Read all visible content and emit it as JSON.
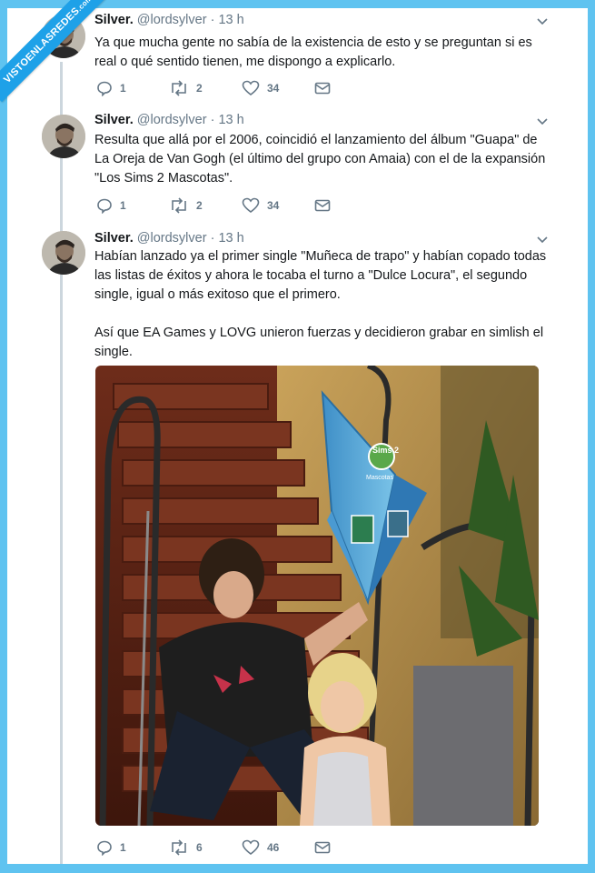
{
  "watermark": {
    "text": "VISTOENLASREDES",
    "suffix": ".com"
  },
  "tweets": [
    {
      "name": "Silver.",
      "handle": "@lordsylver",
      "separator": "·",
      "time": "13 h",
      "paragraphs": [
        "Ya que mucha gente no sabía de la existencia de esto y se preguntan si es real o qué sentido tienen, me dispongo a explicarlo."
      ],
      "replies": "1",
      "retweets": "2",
      "likes": "34"
    },
    {
      "name": "Silver.",
      "handle": "@lordsylver",
      "separator": "·",
      "time": "13 h",
      "paragraphs": [
        "Resulta que allá por el 2006, coincidió el lanzamiento del álbum \"Guapa\" de La Oreja de Van Gogh (el último del grupo con Amaia) con el de la expansión \"Los Sims 2 Mascotas\"."
      ],
      "replies": "1",
      "retweets": "2",
      "likes": "34"
    },
    {
      "name": "Silver.",
      "handle": "@lordsylver",
      "separator": "·",
      "time": "13 h",
      "paragraphs": [
        "Habían lanzado ya el primer single \"Muñeca de trapo\" y habían copado todas las listas de éxitos y ahora le tocaba el turno a \"Dulce Locura\", el segundo single, igual o más exitoso que el primero.",
        "Así que EA Games y LOVG unieron fuerzas y decidieron grabar en simlish el single."
      ],
      "replies": "1",
      "retweets": "6",
      "likes": "46"
    }
  ],
  "photo": {
    "plumbob_logo": "Sims 2",
    "plumbob_sublabel": "Mascotas"
  },
  "colors": {
    "frame": "#5fc3f0",
    "ribbon": "#1ea1e8",
    "muted": "#657786",
    "thread": "#ccd6dd"
  }
}
